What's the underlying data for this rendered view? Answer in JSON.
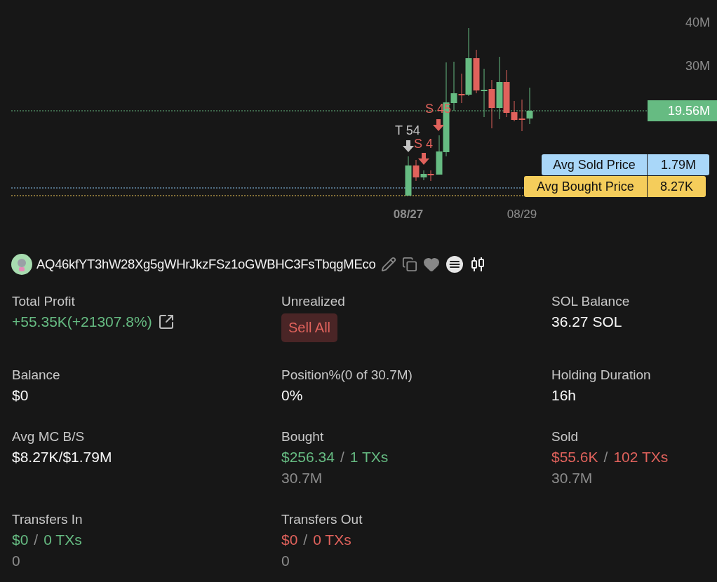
{
  "chart": {
    "y_axis_labels": [
      {
        "label": "40M"
      },
      {
        "label": "30M"
      }
    ],
    "price_tag": "19.56M",
    "avg_tags": [
      {
        "kind": "sold",
        "label": "Avg Sold Price",
        "value": "1.79M"
      },
      {
        "kind": "bought",
        "label": "Avg Bought Price",
        "value": "8.27K"
      }
    ],
    "markers": [
      {
        "kind": "transfer",
        "label": "T 54"
      },
      {
        "kind": "sell",
        "label": "S 4"
      },
      {
        "kind": "sell",
        "label": "S 45"
      }
    ],
    "date_labels": [
      {
        "label": "08/27",
        "emphasized": true
      },
      {
        "label": "08/29",
        "emphasized": false
      }
    ]
  },
  "wallet": {
    "address": "AQ46kfYT3hW28Xg5gWHrJkzFSz1oGWBHC3FsTbqgMEco"
  },
  "stats": [
    {
      "kind": "profit",
      "label": "Total Profit",
      "value": "+55.35K(+21307.8%)"
    },
    {
      "kind": "button",
      "label": "Unrealized",
      "button": "Sell All"
    },
    {
      "kind": "plain",
      "label": "SOL Balance",
      "value": "36.27 SOL"
    },
    {
      "kind": "plain",
      "label": "Balance",
      "value": "$0"
    },
    {
      "kind": "plain",
      "label": "Position%(0 of 30.7M)",
      "value": "0%"
    },
    {
      "kind": "plain",
      "label": "Holding Duration",
      "value": "16h"
    },
    {
      "kind": "plain",
      "label": "Avg MC B/S",
      "value": "$8.27K/$1.79M"
    },
    {
      "kind": "trade",
      "color": "#66bb82",
      "label": "Bought",
      "amount": "$256.34",
      "separator": "/",
      "txs": "1 TXs",
      "sub": "30.7M"
    },
    {
      "kind": "trade",
      "color": "#e0625c",
      "label": "Sold",
      "amount": "$55.6K",
      "separator": "/",
      "txs": "102 TXs",
      "sub": "30.7M"
    },
    {
      "kind": "trade",
      "color": "#66bb82",
      "label": "Transfers In",
      "amount": "$0",
      "separator": "/",
      "txs": "0 TXs",
      "sub": "0"
    },
    {
      "kind": "trade",
      "color": "#e0625c",
      "label": "Transfers Out",
      "amount": "$0",
      "separator": "/",
      "txs": "0 TXs",
      "sub": "0"
    }
  ]
}
